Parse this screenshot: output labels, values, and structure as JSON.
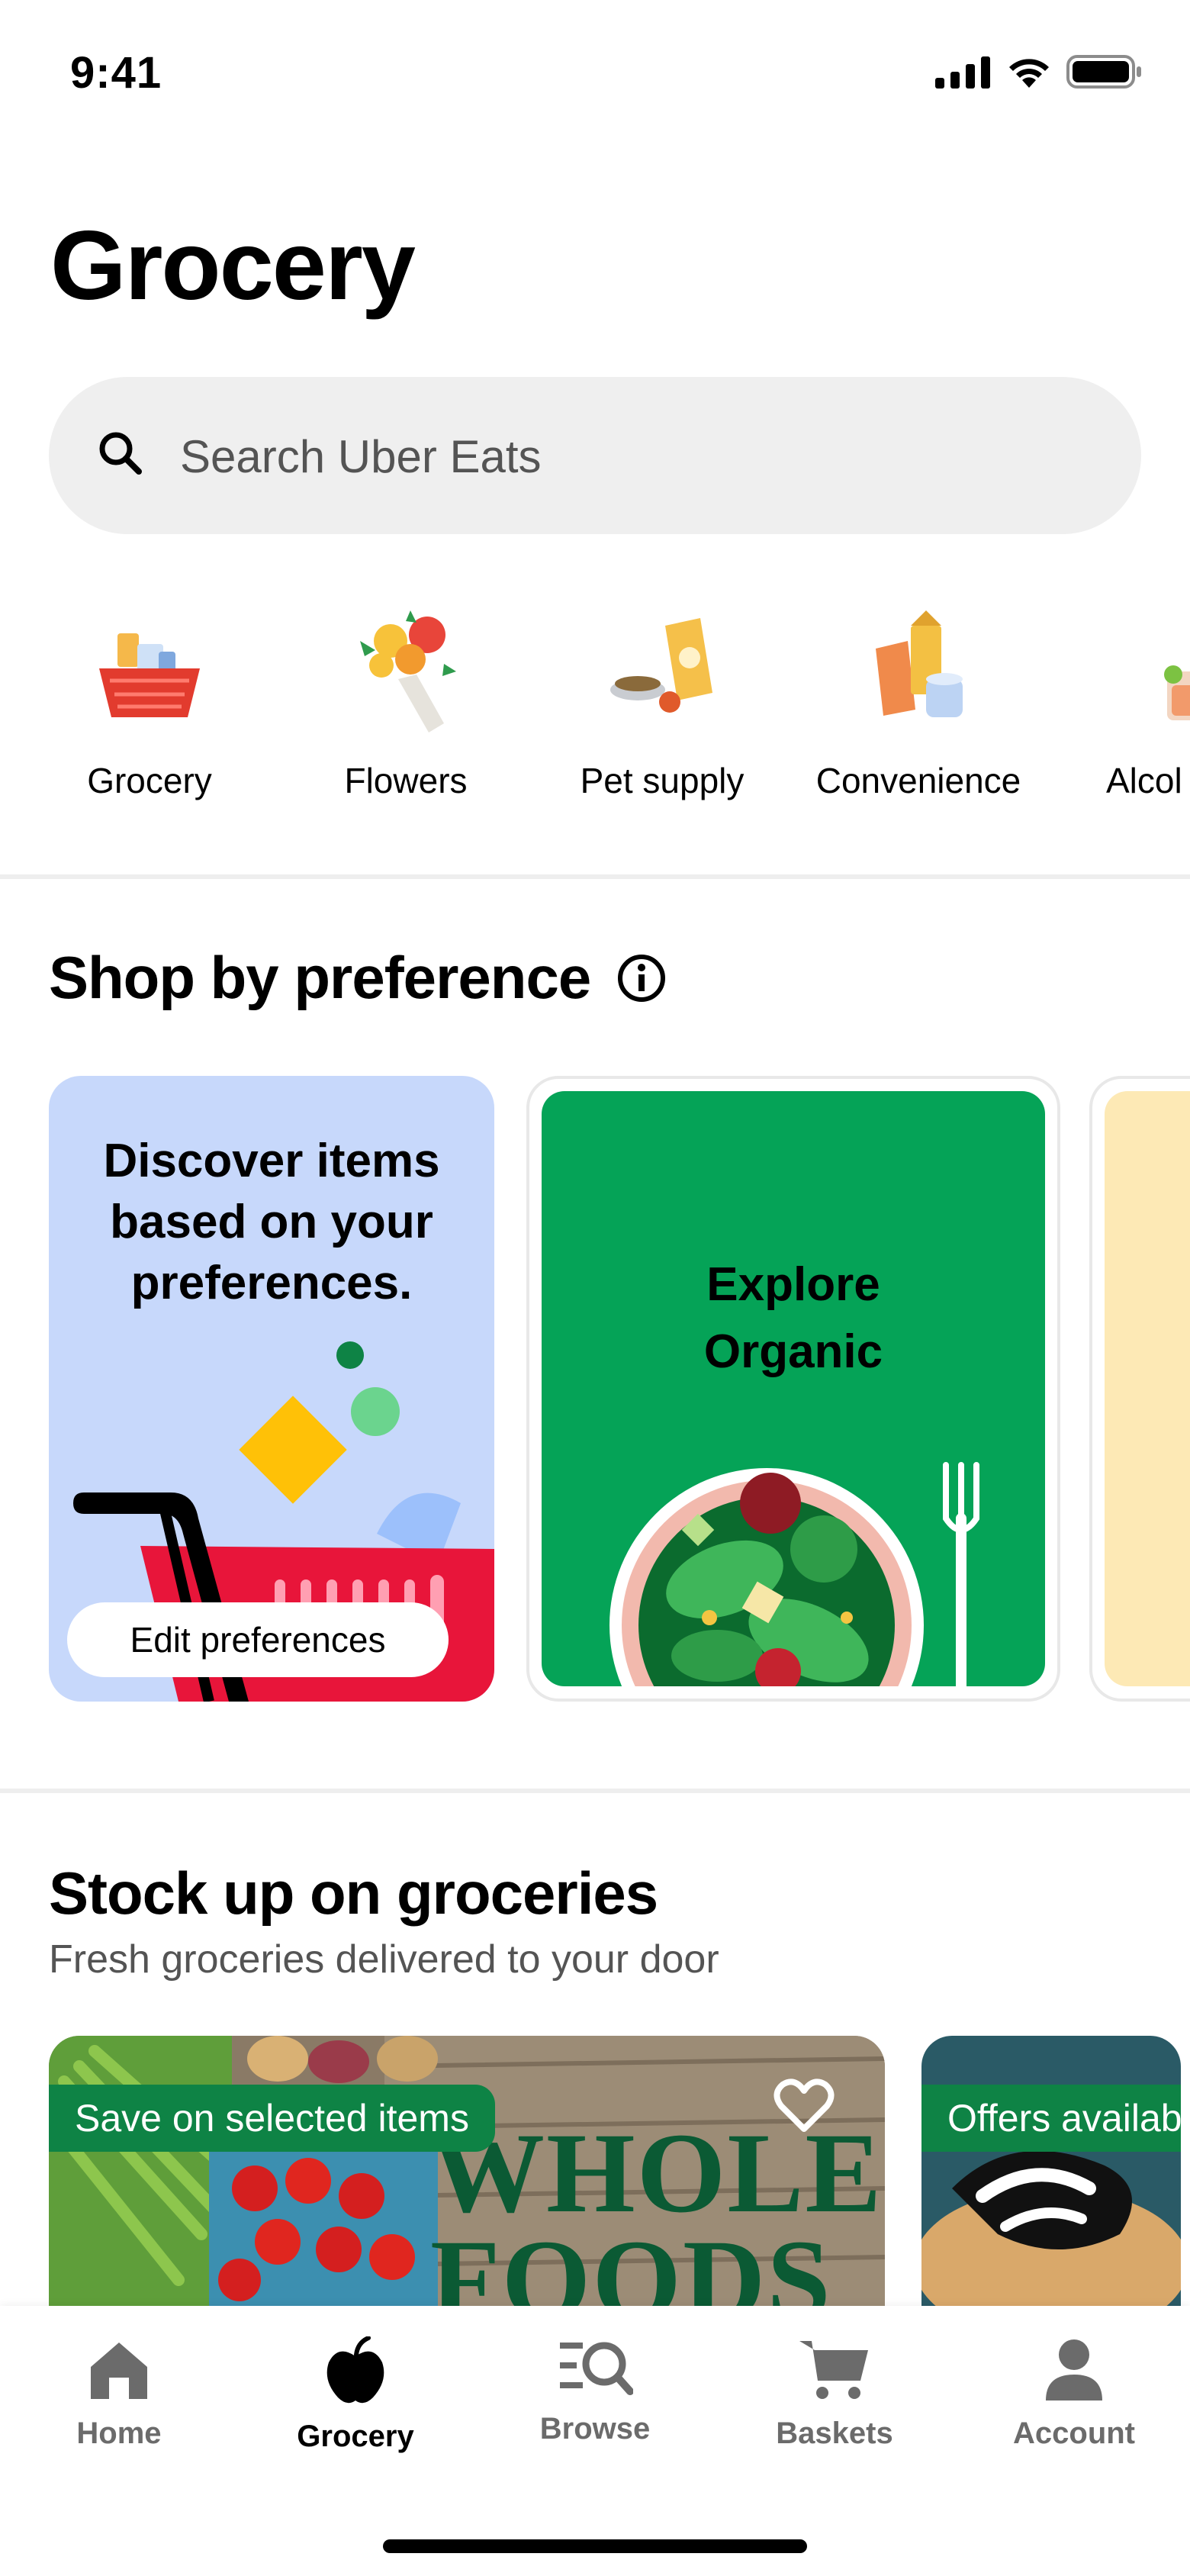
{
  "status": {
    "time": "9:41"
  },
  "page": {
    "title": "Grocery"
  },
  "search": {
    "placeholder": "Search Uber Eats"
  },
  "categories": [
    {
      "label": "Grocery",
      "icon": "grocery-basket-icon"
    },
    {
      "label": "Flowers",
      "icon": "flower-bouquet-icon"
    },
    {
      "label": "Pet supply",
      "icon": "pet-supply-icon"
    },
    {
      "label": "Convenience",
      "icon": "convenience-icon"
    },
    {
      "label": "Alcol",
      "icon": "alcohol-icon"
    }
  ],
  "preference": {
    "title": "Shop by preference",
    "cards": [
      {
        "text": "Discover items based on your preferences.",
        "button": "Edit preferences"
      },
      {
        "text": "Explore Organic"
      }
    ]
  },
  "stock": {
    "title": "Stock up on groceries",
    "subtitle": "Fresh groceries delivered to your door",
    "stores": [
      {
        "promo": "Save on selected items",
        "logo_text": "WHOLE FOODS"
      },
      {
        "promo": "Offers availab"
      }
    ]
  },
  "tabs": [
    {
      "label": "Home",
      "icon": "home-icon",
      "active": false
    },
    {
      "label": "Grocery",
      "icon": "apple-icon",
      "active": true
    },
    {
      "label": "Browse",
      "icon": "browse-icon",
      "active": false
    },
    {
      "label": "Baskets",
      "icon": "cart-icon",
      "active": false
    },
    {
      "label": "Account",
      "icon": "account-icon",
      "active": false
    }
  ],
  "colors": {
    "accent_green": "#05a357",
    "promo_green": "#0e8345",
    "pref_blue": "#c7d8fb",
    "search_bg": "#efefef"
  }
}
